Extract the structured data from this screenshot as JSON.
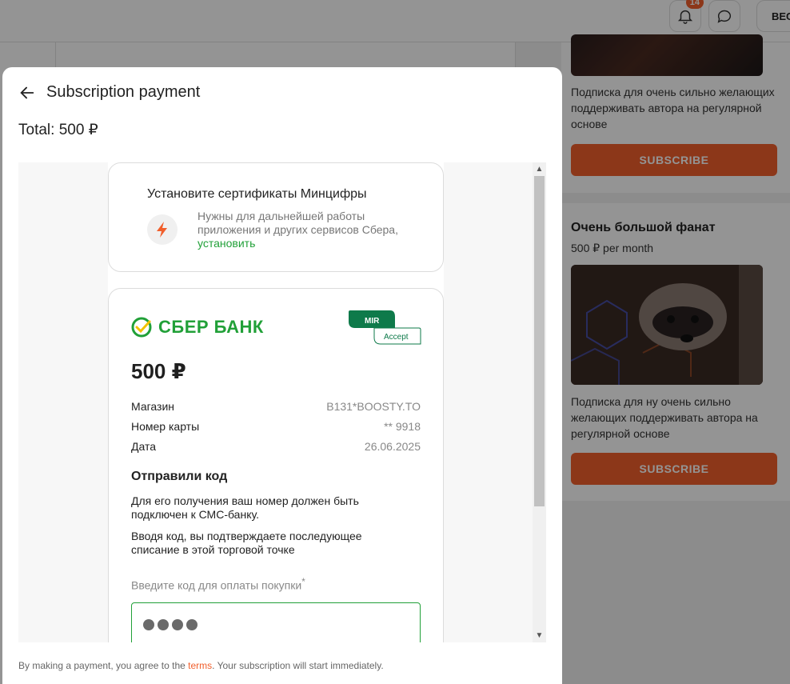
{
  "topbar": {
    "notifications_count": "14",
    "user_chip_text": "BEC"
  },
  "tiers": [
    {
      "description": "Подписка для очень сильно желающих поддерживать автора на регулярной основе",
      "button_label": "SUBSCRIBE"
    },
    {
      "title": "Очень большой фанат",
      "price": "500 ₽ per month",
      "description": "Подписка для ну очень сильно желающих поддерживать автора на регулярной основе",
      "button_label": "SUBSCRIBE"
    }
  ],
  "modal": {
    "title": "Subscription payment",
    "total": "Total: 500 ₽",
    "footer_prefix": "By making a payment, you agree to the ",
    "footer_link": "terms",
    "footer_suffix": ". Your subscription will start immediately."
  },
  "sber": {
    "cert_title": "Установите сертификаты Минцифры",
    "cert_text": "Нужны для дальнейшей работы приложения и других сервисов Сбера, ",
    "cert_link": "установить",
    "logo_text": "СБЕР БАНК",
    "mir_text": "MIR",
    "accept_text": "Accept",
    "amount": "500 ₽",
    "rows": [
      {
        "label": "Магазин",
        "value": "B131*BOOSTY.TO"
      },
      {
        "label": "Номер карты",
        "value": "** 9918"
      },
      {
        "label": "Дата",
        "value": "26.06.2025"
      }
    ],
    "code_title": "Отправили код",
    "code_text_1": "Для его получения ваш номер должен быть подключен к СМС-банку.",
    "code_text_2": "Вводя код, вы подтверждаете последующее списание в этой торговой точке",
    "code_label": "Введите код для оплаты покупки",
    "code_required_mark": "*",
    "code_value": "••••"
  },
  "colors": {
    "accent": "#f15f2c",
    "sber_green": "#21a038"
  }
}
